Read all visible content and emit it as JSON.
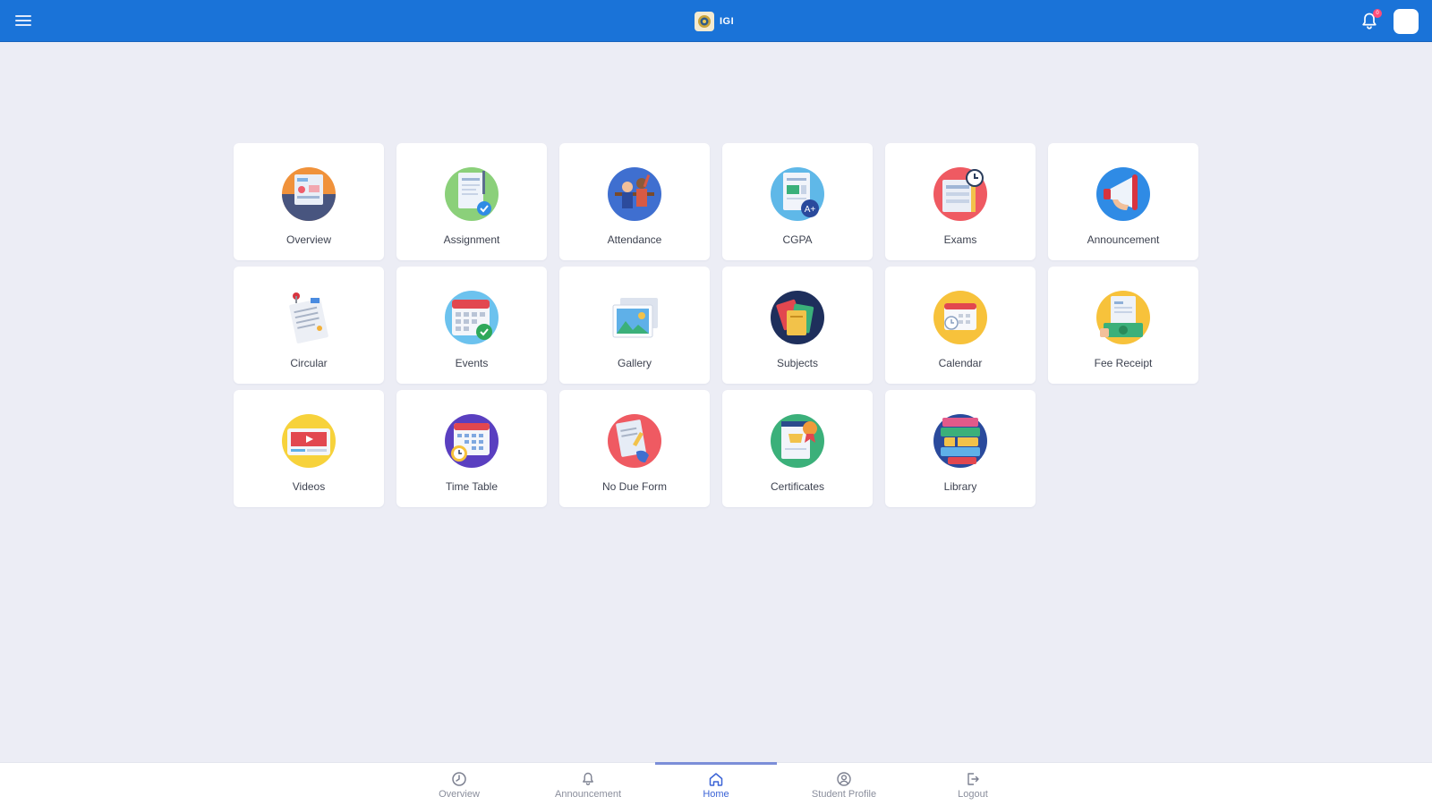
{
  "header": {
    "brand_text": "IGI",
    "notification_count": "0",
    "colors": {
      "bar": "#1a73d8",
      "badge": "#ff4d79"
    }
  },
  "tiles": [
    {
      "label": "Overview",
      "icon": "overview-icon"
    },
    {
      "label": "Assignment",
      "icon": "assignment-icon"
    },
    {
      "label": "Attendance",
      "icon": "attendance-icon"
    },
    {
      "label": "CGPA",
      "icon": "cgpa-icon"
    },
    {
      "label": "Exams",
      "icon": "exams-icon"
    },
    {
      "label": "Announcement",
      "icon": "announcement-icon"
    },
    {
      "label": "Circular",
      "icon": "circular-icon"
    },
    {
      "label": "Events",
      "icon": "events-icon"
    },
    {
      "label": "Gallery",
      "icon": "gallery-icon"
    },
    {
      "label": "Subjects",
      "icon": "subjects-icon"
    },
    {
      "label": "Calendar",
      "icon": "calendar-icon"
    },
    {
      "label": "Fee Receipt",
      "icon": "fee-receipt-icon"
    },
    {
      "label": "Videos",
      "icon": "videos-icon"
    },
    {
      "label": "Time Table",
      "icon": "time-table-icon"
    },
    {
      "label": "No Due Form",
      "icon": "no-due-form-icon"
    },
    {
      "label": "Certificates",
      "icon": "certificates-icon"
    },
    {
      "label": "Library",
      "icon": "library-icon"
    }
  ],
  "bottom_nav": [
    {
      "label": "Overview",
      "icon": "clock-icon",
      "active": false
    },
    {
      "label": "Announcement",
      "icon": "bell-icon",
      "active": false
    },
    {
      "label": "Home",
      "icon": "home-icon",
      "active": true
    },
    {
      "label": "Student Profile",
      "icon": "user-circle-icon",
      "active": false
    },
    {
      "label": "Logout",
      "icon": "logout-icon",
      "active": false
    }
  ]
}
